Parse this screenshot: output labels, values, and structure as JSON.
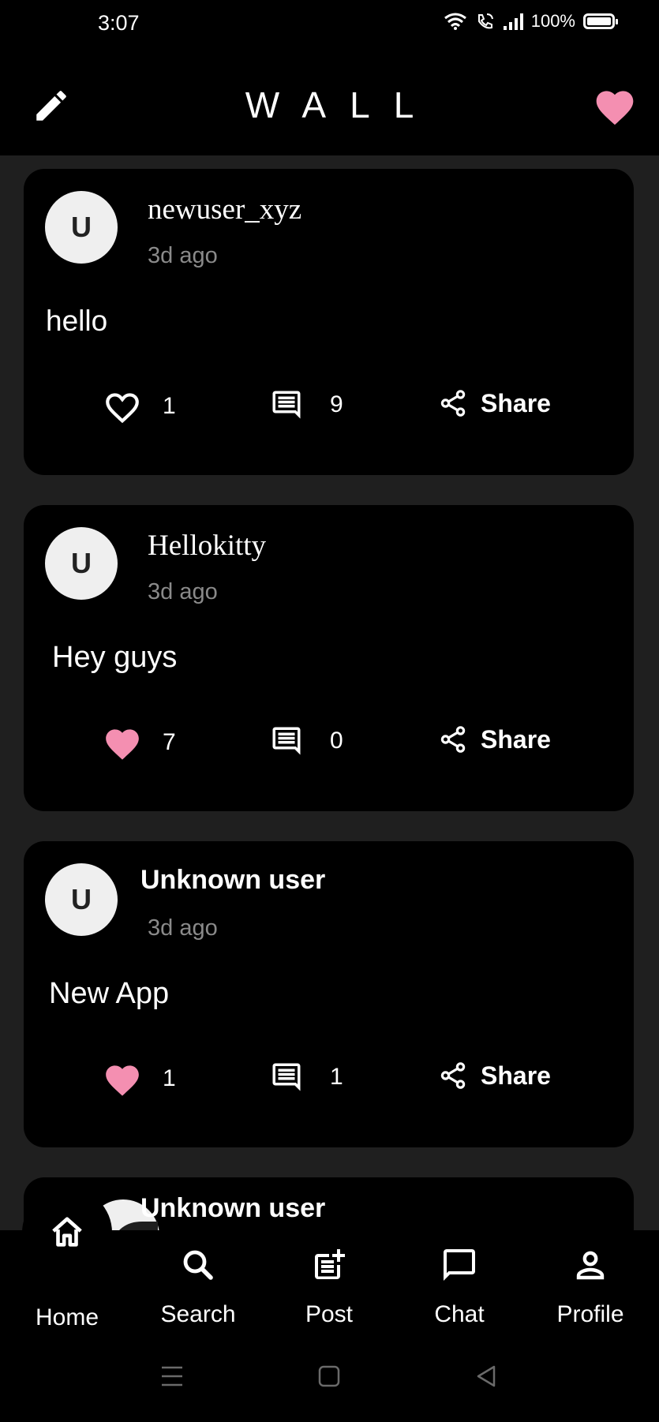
{
  "status_bar": {
    "time": "3:07",
    "battery": "100%"
  },
  "header": {
    "title": "WALL"
  },
  "posts": [
    {
      "avatar_letter": "U",
      "username": "newuser_xyz",
      "time": "3d ago",
      "text": "hello",
      "likes": "1",
      "liked": false,
      "comments": "9",
      "share_label": "Share"
    },
    {
      "avatar_letter": "U",
      "username": "Hellokitty",
      "time": "3d ago",
      "text": "Hey guys",
      "likes": "7",
      "liked": true,
      "comments": "0",
      "share_label": "Share"
    },
    {
      "avatar_letter": "U",
      "username": "Unknown user",
      "time": "3d ago",
      "text": "New App",
      "likes": "1",
      "liked": true,
      "comments": "1",
      "share_label": "Share"
    },
    {
      "username": "Unknown user"
    }
  ],
  "nav": {
    "home": "Home",
    "search": "Search",
    "post": "Post",
    "chat": "Chat",
    "profile": "Profile"
  },
  "colors": {
    "accent": "#f48fb1",
    "background": "#000000",
    "feed_bg": "#1f1f1f",
    "muted": "#8a8a8a"
  },
  "icons": [
    "edit-icon",
    "heart-icon",
    "comment-icon",
    "share-icon",
    "home-icon",
    "search-icon",
    "post-add-icon",
    "chat-icon",
    "profile-icon"
  ]
}
